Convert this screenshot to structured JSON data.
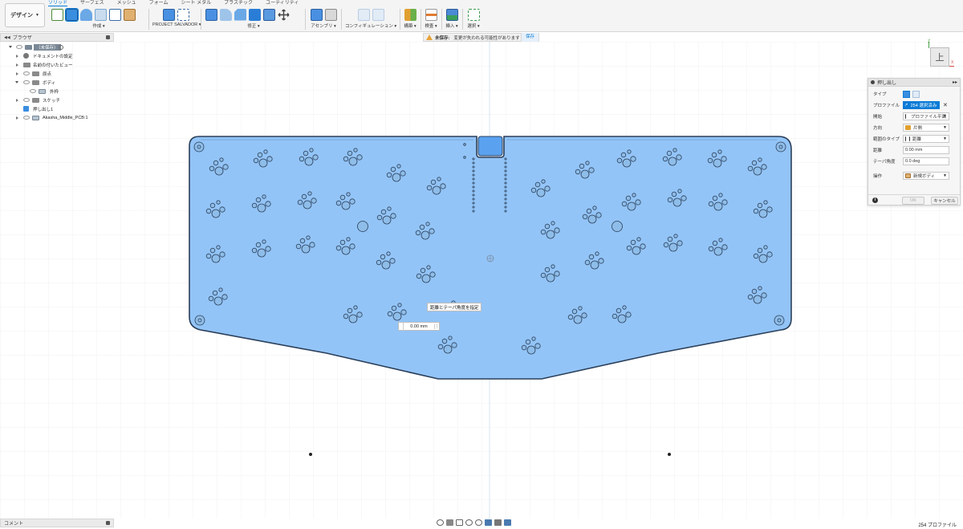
{
  "workspace": {
    "label": "デザイン"
  },
  "tabs": [
    {
      "label": "ソリッド",
      "active": true
    },
    {
      "label": "サーフェス",
      "active": false
    },
    {
      "label": "メッシュ",
      "active": false
    },
    {
      "label": "フォーム",
      "active": false
    },
    {
      "label": "シート メタル",
      "active": false
    },
    {
      "label": "プラスチック",
      "active": false
    },
    {
      "label": "ユーティリティ",
      "active": false
    }
  ],
  "toolbar_groups": {
    "create": "作成",
    "project": "PROJECT SALVADOR",
    "modify": "修正",
    "assemble": "アセンブリ",
    "configure": "コンフィギュレーション",
    "construct": "構築",
    "inspect": "検査",
    "insert": "挿入",
    "select": "選択"
  },
  "browser": {
    "title": "ブラウザ",
    "items": [
      {
        "label": "（未保存）"
      },
      {
        "label": "ドキュメントの設定"
      },
      {
        "label": "名前の付いたビュー"
      },
      {
        "label": "原点"
      },
      {
        "label": "ボディ"
      },
      {
        "label": "外枠"
      },
      {
        "label": "スケッチ"
      },
      {
        "label": "押し出し1"
      },
      {
        "label": "Akasha_Middle_PCB:1"
      }
    ]
  },
  "notification": {
    "status": "未保存:",
    "message": "変更が失われる可能性があります",
    "save_label": "保存"
  },
  "viewcube": {
    "face_label": "上",
    "axis_z": "Z",
    "axis_x": "X"
  },
  "extrude_dialog": {
    "title": "押し出し",
    "type_label": "タイプ",
    "profile_label": "プロファイル",
    "profile_value": "254 選択済み",
    "start_label": "開始",
    "start_value": "プロファイル平面",
    "direction_label": "方向",
    "direction_value": "片側",
    "extent_type_label": "範囲のタイプ",
    "extent_type_value": "距離",
    "distance_label": "距離",
    "distance_value": "0.00 mm",
    "taper_label": "テーパ角度",
    "taper_value": "0.0 deg",
    "operation_label": "操作",
    "operation_value": "新規ボディ",
    "ok_label": "OK",
    "cancel_label": "キャンセル"
  },
  "canvas": {
    "tooltip": "距離とテーパ角度を指定",
    "distance_input": "0.00 mm"
  },
  "comments": {
    "label": "コメント"
  },
  "status": {
    "profile_count": "254 プロファイル"
  },
  "colors": {
    "accent": "#0a7bd6",
    "plate_fill": "#93c4f7",
    "plate_stroke": "#2a3f5a",
    "folder": "#8a8a8a",
    "selected_row": "#7a8896"
  }
}
